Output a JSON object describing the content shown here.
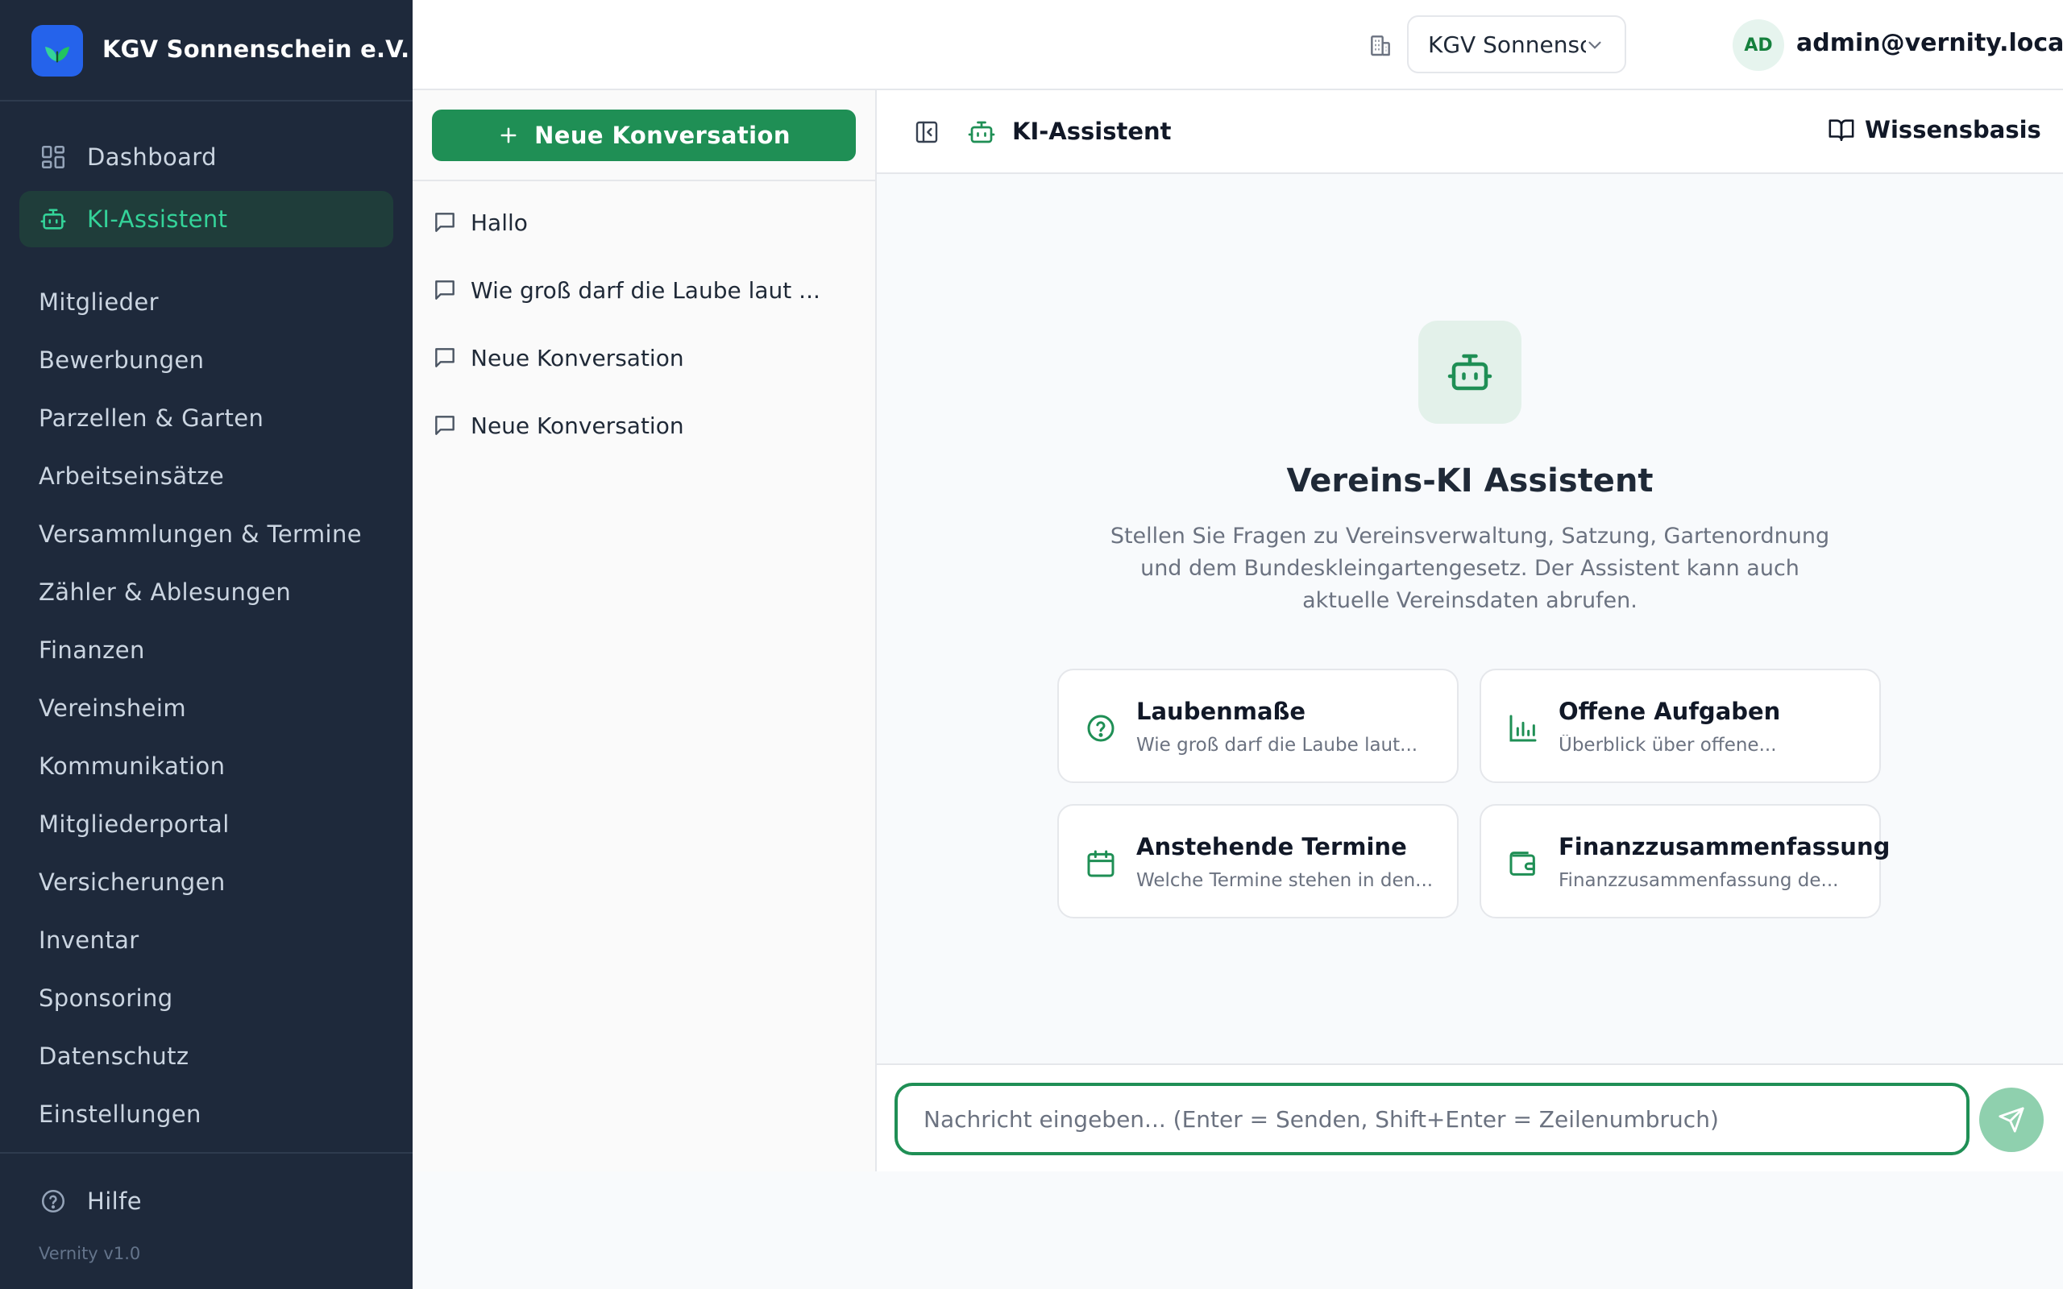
{
  "brand": {
    "name": "KGV Sonnenschein e.V."
  },
  "sidebar": {
    "primary": [
      {
        "label": "Dashboard",
        "icon": "dashboard-grid-icon"
      },
      {
        "label": "KI-Assistent",
        "icon": "bot-icon",
        "active": true
      }
    ],
    "items": [
      "Mitglieder",
      "Bewerbungen",
      "Parzellen & Garten",
      "Arbeitseinsätze",
      "Versammlungen & Termine",
      "Zähler & Ablesungen",
      "Finanzen",
      "Vereinsheim",
      "Kommunikation",
      "Mitgliederportal",
      "Versicherungen",
      "Inventar",
      "Sponsoring",
      "Datenschutz",
      "Einstellungen"
    ],
    "help_label": "Hilfe",
    "version": "Vernity v1.0"
  },
  "topbar": {
    "org_select_value": "KGV Sonnenschein e.V.",
    "avatar_initials": "AD",
    "user_email": "admin@vernity.local"
  },
  "conversations": {
    "new_label": "Neue Konversation",
    "items": [
      "Hallo",
      "Wie groß darf die Laube laut ...",
      "Neue Konversation",
      "Neue Konversation"
    ]
  },
  "chat": {
    "title": "KI-Assistent",
    "knowledge_base_label": "Wissensbasis",
    "hero_title": "Vereins-KI Assistent",
    "hero_desc": "Stellen Sie Fragen zu Vereinsverwaltung, Satzung, Gartenordnung und dem Bundeskleingartengesetz. Der Assistent kann auch aktuelle Vereinsdaten abrufen.",
    "suggestions": [
      {
        "title": "Laubenmaße",
        "subtitle": "Wie groß darf die Laube laut...",
        "icon": "help-circle-icon"
      },
      {
        "title": "Offene Aufgaben",
        "subtitle": "Überblick über offene...",
        "icon": "bar-chart-icon"
      },
      {
        "title": "Anstehende Termine",
        "subtitle": "Welche Termine stehen in den...",
        "icon": "calendar-icon"
      },
      {
        "title": "Finanzzusammenfassung",
        "subtitle": "Finanzzusammenfassung de...",
        "icon": "wallet-icon"
      }
    ],
    "composer_placeholder": "Nachricht eingeben... (Enter = Senden, Shift+Enter = Zeilenumbruch)"
  },
  "colors": {
    "sidebar_bg": "#1e293b",
    "accent_green": "#1f8f55",
    "active_text": "#34d399",
    "brand_blue": "#2563eb"
  }
}
